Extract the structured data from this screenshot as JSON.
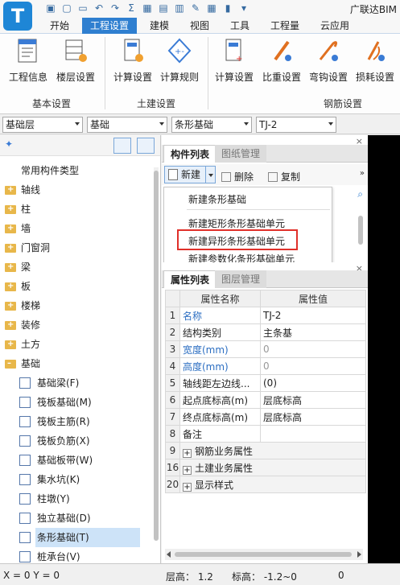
{
  "app": {
    "title": "广联达BIM"
  },
  "ribbon": {
    "tabs": [
      "开始",
      "工程设置",
      "建模",
      "视图",
      "工具",
      "工程量",
      "云应用"
    ],
    "active_tab": "工程设置",
    "buttons": {
      "project_info": "工程信息",
      "floor_settings": "楼层设置",
      "calc_settings_1": "计算设置",
      "calc_rules": "计算规则",
      "calc_settings_2": "计算设置",
      "weight_settings": "比重设置",
      "bend_settings": "弯钩设置",
      "loss_settings": "损耗设置"
    },
    "groups": {
      "basic": "基本设置",
      "civil": "土建设置",
      "rebar": "钢筋设置"
    }
  },
  "combos": {
    "floor": "基础层",
    "category": "基础",
    "type": "条形基础",
    "component": "TJ-2"
  },
  "tree": {
    "root": "常用构件类型",
    "folders": [
      "轴线",
      "柱",
      "墙",
      "门窗洞",
      "梁",
      "板",
      "楼梯",
      "装修",
      "土方",
      "基础"
    ],
    "leaves": [
      "基础梁(F)",
      "筏板基础(M)",
      "筏板主筋(R)",
      "筏板负筋(X)",
      "基础板带(W)",
      "集水坑(K)",
      "柱墩(Y)",
      "独立基础(D)",
      "条形基础(T)",
      "桩承台(V)"
    ],
    "selected": "条形基础(T)"
  },
  "component_panel": {
    "tabs": [
      "构件列表",
      "图纸管理"
    ],
    "new_label": "新建",
    "delete_label": "删除",
    "copy_label": "复制"
  },
  "menu": {
    "items": [
      "新建条形基础",
      "新建矩形条形基础单元",
      "新建异形条形基础单元",
      "新建参数化条形基础单元"
    ],
    "highlighted": "新建异形条形基础单元"
  },
  "property_panel": {
    "tabs": [
      "属性列表",
      "图层管理"
    ],
    "headers": {
      "name": "属性名称",
      "value": "属性值"
    },
    "rows": [
      {
        "n": "1",
        "name": "名称",
        "value": "TJ-2"
      },
      {
        "n": "2",
        "name": "结构类别",
        "value": "主条基"
      },
      {
        "n": "3",
        "name": "宽度(mm)",
        "value": "0"
      },
      {
        "n": "4",
        "name": "高度(mm)",
        "value": "0"
      },
      {
        "n": "5",
        "name": "轴线距左边线...",
        "value": "(0)"
      },
      {
        "n": "6",
        "name": "起点底标高(m)",
        "value": "层底标高"
      },
      {
        "n": "7",
        "name": "终点底标高(m)",
        "value": "层底标高"
      },
      {
        "n": "8",
        "name": "备注",
        "value": ""
      },
      {
        "n": "9",
        "name": "钢筋业务属性",
        "value": ""
      },
      {
        "n": "16",
        "name": "土建业务属性",
        "value": ""
      },
      {
        "n": "20",
        "name": "显示样式",
        "value": ""
      }
    ]
  },
  "status": {
    "coords": "X = 0 Y = 0",
    "floor_height": "层高： 1.2",
    "elevation": "标高： -1.2~0",
    "extra": "0"
  }
}
